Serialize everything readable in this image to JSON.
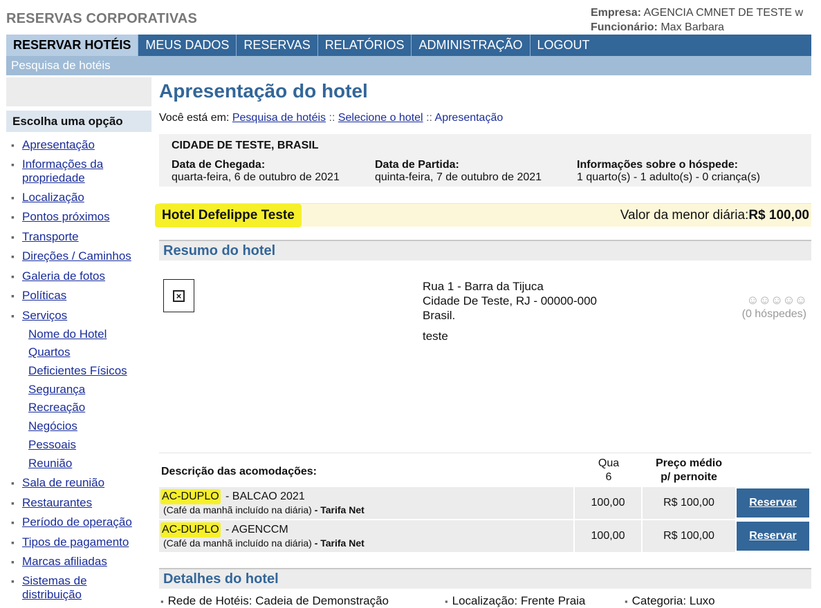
{
  "header": {
    "brand": "RESERVAS CORPORATIVAS",
    "company_label": "Empresa:",
    "company_value": "AGENCIA CMNET DE TESTE w",
    "employee_label": "Funcionário:",
    "employee_value": "Max Barbara"
  },
  "nav": {
    "items": [
      "RESERVAR HOTÉIS",
      "MEUS DADOS",
      "RESERVAS",
      "RELATÓRIOS",
      "ADMINISTRAÇÃO",
      "LOGOUT"
    ],
    "sub": "Pesquisa de hotéis"
  },
  "sidebar": {
    "title": "Escolha uma opção",
    "items": [
      "Apresentação",
      "Informações da propriedade",
      "Localização",
      "Pontos próximos",
      "Transporte",
      "Direções / Caminhos",
      "Galeria de fotos",
      "Políticas",
      "Serviços"
    ],
    "sub_items": [
      "Nome do Hotel",
      "Quartos",
      "Deficientes Físicos",
      "Segurança",
      "Recreação",
      "Negócios",
      "Pessoais",
      "Reunião"
    ],
    "items2": [
      "Sala de reunião",
      "Restaurantes",
      "Período de operação",
      "Tipos de pagamento",
      "Marcas afiliadas",
      "Sistemas de distribuição"
    ]
  },
  "main": {
    "title": "Apresentação do hotel",
    "breadcrumb": {
      "prefix": "Você está em:",
      "link1": "Pesquisa de hotéis",
      "sep": "::",
      "link2": "Selecione o hotel",
      "current": "Apresentação"
    },
    "search": {
      "city": "CIDADE DE TESTE, BRASIL",
      "arrival_label": "Data de Chegada:",
      "arrival_value": "quarta-feira, 6 de outubro de 2021",
      "departure_label": "Data de Partida:",
      "departure_value": "quinta-feira, 7 de outubro de 2021",
      "guest_label": "Informações sobre o hóspede:",
      "guest_value": "1 quarto(s) - 1 adulto(s) - 0 criança(s)"
    },
    "hotel": {
      "name": "Hotel Defelippe Teste",
      "price_label": "Valor da menor diária:",
      "price_value": "R$ 100,00"
    },
    "summary": {
      "title": "Resumo do hotel",
      "address_line1": "Rua 1 - Barra da Tijuca",
      "address_line2": "Cidade De Teste, RJ - 00000-000",
      "address_line3": "Brasil.",
      "description": "teste",
      "rating_faces": "☺☺☺☺☺",
      "rating_count": "(0 hóspedes)"
    },
    "rooms": {
      "col_desc": "Descrição das acomodações:",
      "col_qty_line1": "Qua",
      "col_qty_line2": "6",
      "col_price_line1": "Preço médio",
      "col_price_line2": "p/ pernoite",
      "rows": [
        {
          "code": "AC-DUPLO",
          "name": "- BALCAO 2021",
          "note": "(Café da manhã incluído na diária)",
          "tariff": "- Tarifa Net",
          "qty": "100,00",
          "price": "R$ 100,00",
          "action": "Reservar"
        },
        {
          "code": "AC-DUPLO",
          "name": "- AGENCCM",
          "note": "(Café da manhã incluído na diária)",
          "tariff": "- Tarifa Net",
          "qty": "100,00",
          "price": "R$ 100,00",
          "action": "Reservar"
        }
      ]
    },
    "details": {
      "title": "Detalhes do hotel",
      "bullet": "▪",
      "items": [
        "Rede de Hotéis: Cadeia de Demonstração",
        "Localização: Frente Praia",
        "Categoria: Luxo"
      ]
    }
  }
}
